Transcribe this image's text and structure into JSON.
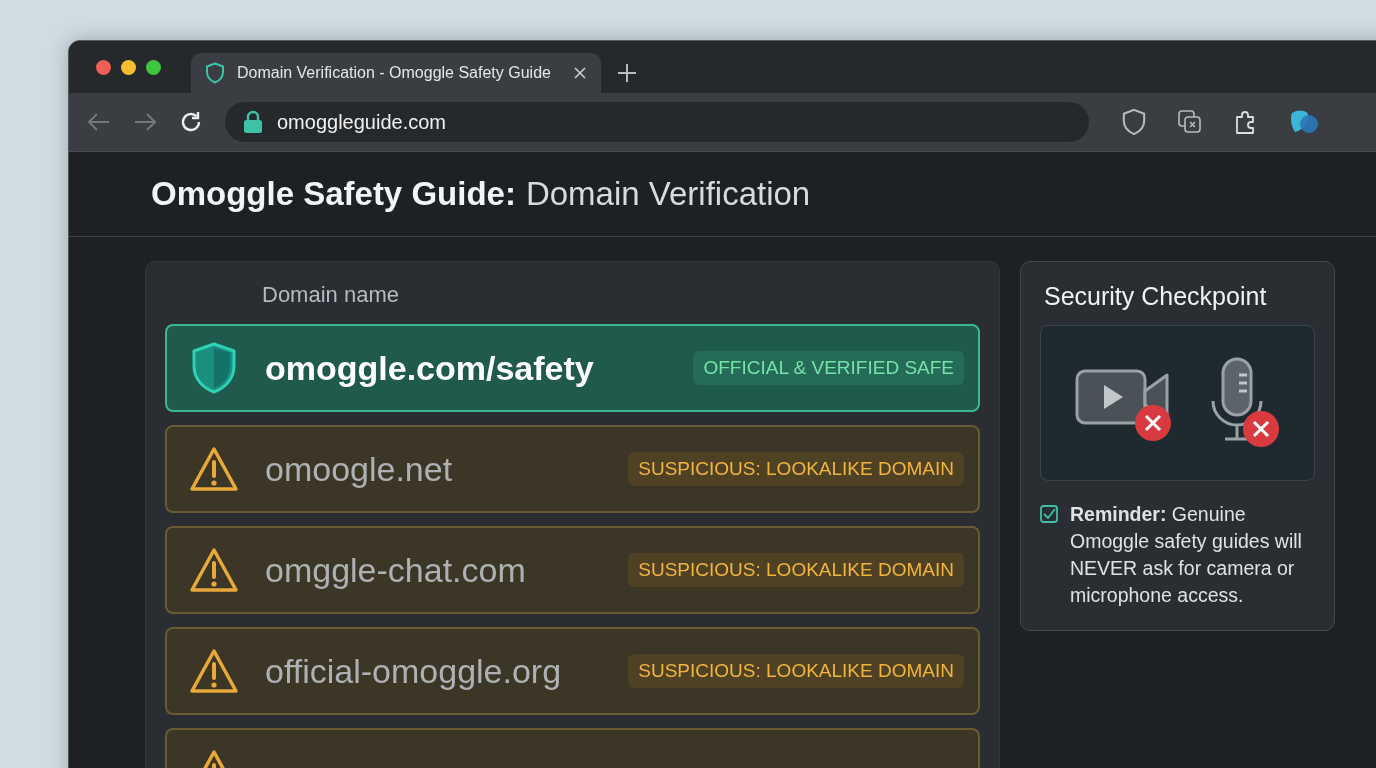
{
  "tabs": [
    {
      "title": "Domain Verification - Omoggle Safety Guide",
      "selected": true
    }
  ],
  "address_bar": {
    "url": "omoggleguide.com"
  },
  "page": {
    "title_bold": "Omoggle Safety Guide:",
    "title_rest": "Domain Verification"
  },
  "domain_list": {
    "column_header": "Domain name",
    "rows": [
      {
        "kind": "verified",
        "domain": "omoggle.com/safety",
        "badge": "OFFICIAL & VERIFIED SAFE"
      },
      {
        "kind": "suspicious",
        "domain": "omoogle.net",
        "badge": "SUSPICIOUS: LOOKALIKE DOMAIN"
      },
      {
        "kind": "suspicious",
        "domain": "omggle-chat.com",
        "badge": "SUSPICIOUS: LOOKALIKE DOMAIN"
      },
      {
        "kind": "suspicious",
        "domain": "official-omoggle.org",
        "badge": "SUSPICIOUS: LOOKALIKE DOMAIN"
      },
      {
        "kind": "suspicious"
      }
    ]
  },
  "checkpoint": {
    "title": "Security Checkpoint",
    "reminder": {
      "checked": true,
      "text": "**Reminder:** Genuine Omoggle safety guides will NEVER ask for camera or microphone access."
    }
  }
}
